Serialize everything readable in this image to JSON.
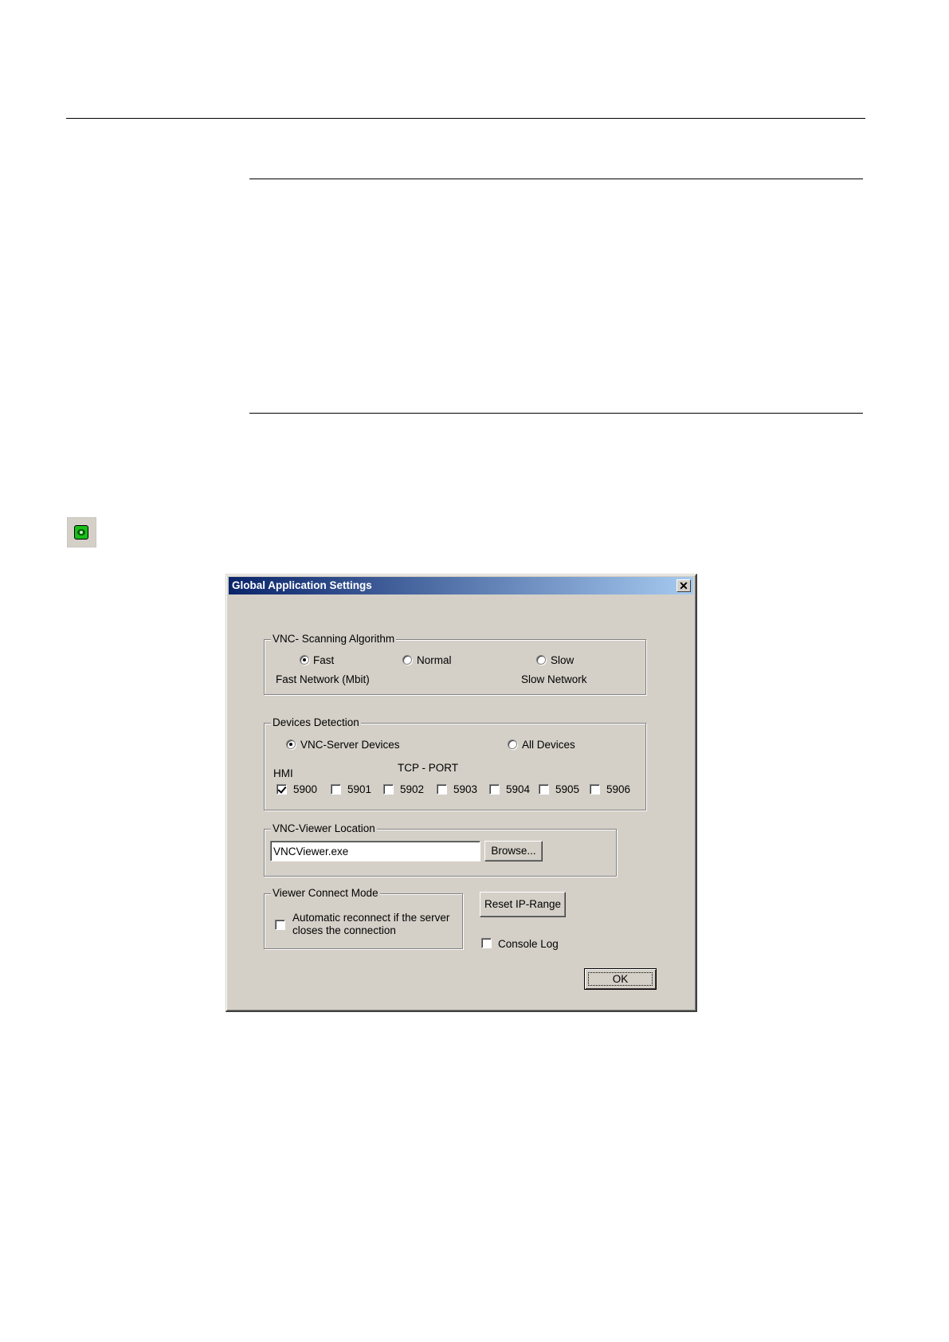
{
  "dialog": {
    "title": "Global Application Settings",
    "close_symbol": "✕",
    "scanning": {
      "legend": "VNC- Scanning Algorithm",
      "options": [
        {
          "label": "Fast",
          "selected": true
        },
        {
          "label": "Normal",
          "selected": false
        },
        {
          "label": "Slow",
          "selected": false
        }
      ],
      "left_caption": "Fast Network (Mbit)",
      "right_caption": "Slow Network"
    },
    "detection": {
      "legend": "Devices Detection",
      "options": [
        {
          "label": "VNC-Server Devices",
          "selected": true
        },
        {
          "label": "All Devices",
          "selected": false
        }
      ],
      "hmi_label": "HMI",
      "port_label": "TCP - PORT",
      "ports": [
        {
          "label": "5900",
          "checked": true
        },
        {
          "label": "5901",
          "checked": false
        },
        {
          "label": "5902",
          "checked": false
        },
        {
          "label": "5903",
          "checked": false
        },
        {
          "label": "5904",
          "checked": false
        },
        {
          "label": "5905",
          "checked": false
        },
        {
          "label": "5906",
          "checked": false
        }
      ]
    },
    "viewer_location": {
      "legend": "VNC-Viewer Location",
      "value": "VNCViewer.exe",
      "browse_label": "Browse..."
    },
    "connect_mode": {
      "legend": "Viewer Connect Mode",
      "reconnect_line1": "Automatic reconnect if the server",
      "reconnect_line2": "closes the connection",
      "reconnect_checked": false
    },
    "reset_label": "Reset IP-Range",
    "console_log_label": "Console Log",
    "console_log_checked": false,
    "ok_label": "OK"
  },
  "icons": {
    "toolbar_button": "vnc-eye-icon",
    "close": "close-icon"
  }
}
